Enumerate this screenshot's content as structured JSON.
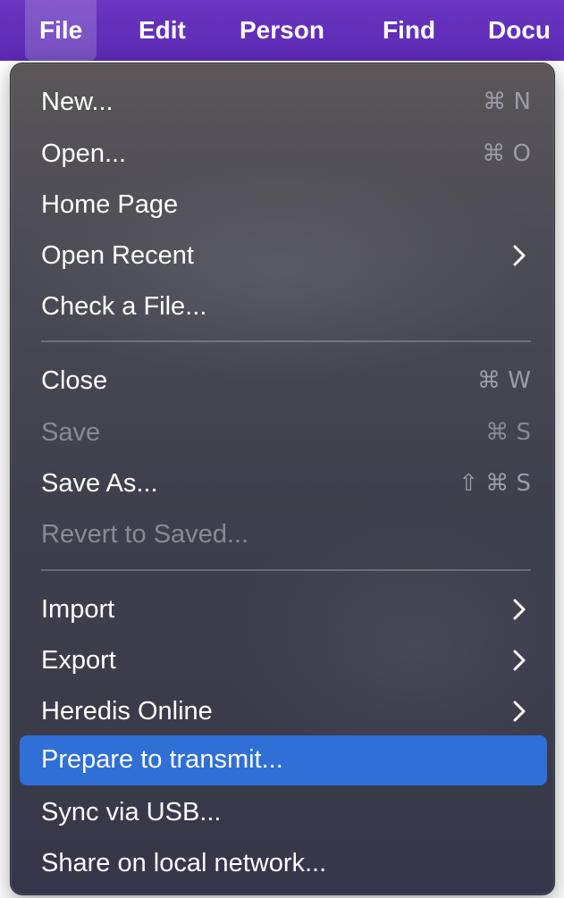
{
  "menubar": {
    "items": [
      {
        "label": "File"
      },
      {
        "label": "Edit"
      },
      {
        "label": "Person"
      },
      {
        "label": "Find"
      },
      {
        "label": "Docu"
      }
    ],
    "active": "File",
    "background": "#5a2ab3"
  },
  "file_menu": {
    "items": [
      {
        "label": "New...",
        "shortcut": "⌘ N",
        "enabled": true
      },
      {
        "label": "Open...",
        "shortcut": "⌘ O",
        "enabled": true
      },
      {
        "label": "Home Page",
        "shortcut": "",
        "enabled": true
      },
      {
        "label": "Open Recent",
        "submenu": true,
        "enabled": true
      },
      {
        "label": "Check a File...",
        "shortcut": "",
        "enabled": true
      },
      {
        "label": "Close",
        "shortcut": "⌘ W",
        "enabled": true
      },
      {
        "label": "Save",
        "shortcut": "⌘ S",
        "enabled": false
      },
      {
        "label": "Save As...",
        "shortcut": "⇧ ⌘ S",
        "enabled": true
      },
      {
        "label": "Revert to Saved...",
        "shortcut": "",
        "enabled": false
      },
      {
        "label": "Import",
        "submenu": true,
        "enabled": true
      },
      {
        "label": "Export",
        "submenu": true,
        "enabled": true
      },
      {
        "label": "Heredis Online",
        "submenu": true,
        "enabled": true
      },
      {
        "label": "Prepare to transmit...",
        "shortcut": "",
        "enabled": true,
        "highlighted": true
      },
      {
        "label": "Sync via USB...",
        "shortcut": "",
        "enabled": true
      },
      {
        "label": "Share on local network...",
        "shortcut": "",
        "enabled": true
      }
    ],
    "highlight_color": "#2f6fd6"
  }
}
